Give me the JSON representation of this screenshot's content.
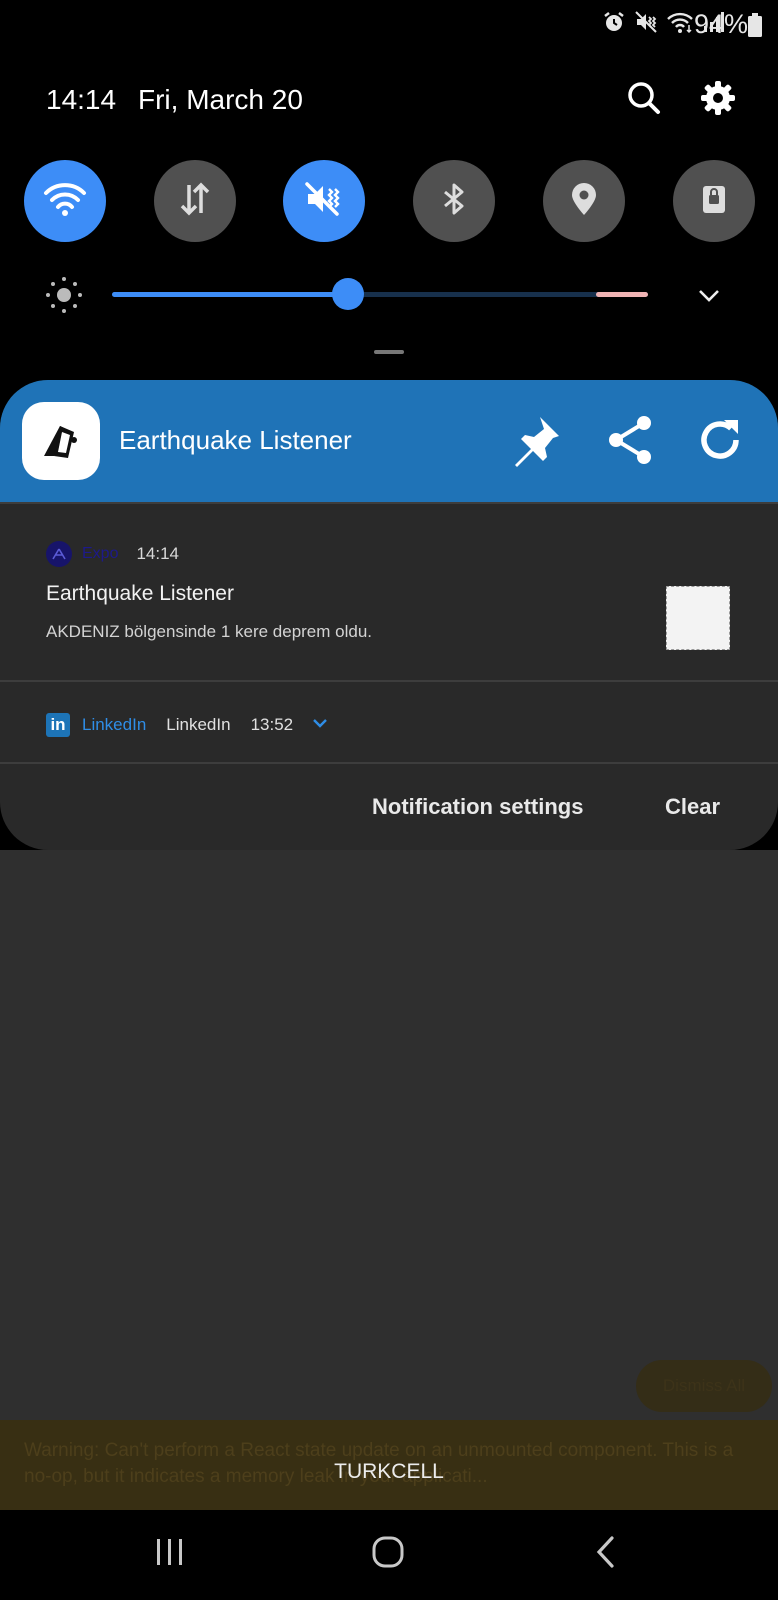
{
  "status_bar": {
    "battery": "94%",
    "icons": [
      "alarm-icon",
      "vibrate-icon",
      "wifi-icon",
      "signal-icon",
      "battery-icon"
    ]
  },
  "header": {
    "time": "14:14",
    "date": "Fri, March 20",
    "search_icon": "search-icon",
    "settings_icon": "gear-icon"
  },
  "quick_tiles": [
    {
      "name": "wifi",
      "icon": "wifi-icon",
      "on": true
    },
    {
      "name": "mobile-data",
      "icon": "data-arrows-icon",
      "on": false
    },
    {
      "name": "sound",
      "icon": "vibrate-icon",
      "on": true
    },
    {
      "name": "bluetooth",
      "icon": "bluetooth-icon",
      "on": false
    },
    {
      "name": "location",
      "icon": "location-pin-icon",
      "on": false
    },
    {
      "name": "screen-lock",
      "icon": "lock-icon",
      "on": false
    }
  ],
  "brightness": {
    "level": 0.44
  },
  "app_notification": {
    "app_title": "Earthquake Listener",
    "actions": [
      "pin-icon",
      "share-icon",
      "refresh-icon"
    ]
  },
  "notifications": [
    {
      "source": "Expo",
      "time": "14:14",
      "title": "Earthquake Listener",
      "body": "AKDENIZ bölgensinde 1 kere  deprem oldu."
    },
    {
      "source": "LinkedIn",
      "title": "LinkedIn",
      "time": "13:52"
    }
  ],
  "panel_buttons": {
    "settings": "Notification settings",
    "clear": "Clear"
  },
  "overlay": {
    "dismiss_all": "Dismiss All",
    "warning": "Warning: Can't perform a React state update on an unmounted component. This is a no-op, but it indicates a memory leak in your applicati...",
    "carrier": "TURKCELL"
  },
  "colors": {
    "accent": "#3d8df7",
    "app_header": "#1f73b7",
    "panel": "#292929"
  }
}
